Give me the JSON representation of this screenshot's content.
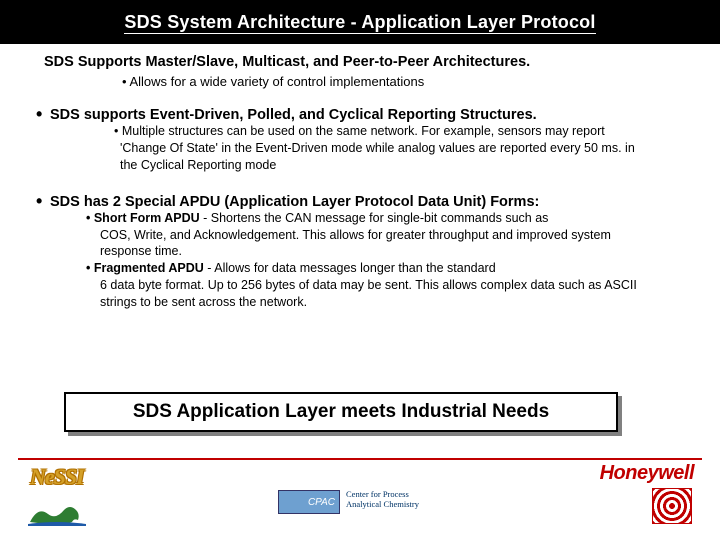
{
  "title": "SDS System Architecture - Application Layer Protocol",
  "sec1": {
    "head": "SDS Supports Master/Slave, Multicast, and Peer-to-Peer Architectures.",
    "sub": "•   Allows for a wide variety of control implementations"
  },
  "sec2": {
    "head": "SDS supports Event-Driven, Polled, and Cyclical Reporting Structures.",
    "sub": "• Multiple structures can be used on the same network.  For example, sensors may report 'Change Of State' in the Event-Driven mode while analog values are reported every 50 ms. in the Cyclical Reporting mode"
  },
  "sec3": {
    "head": "SDS has 2 Special APDU (Application Layer Protocol Data Unit) Forms:",
    "item1_lead": "• Short Form APDU",
    "item1_rest": " - Shortens the CAN message for single-bit commands such as",
    "item1_cont": "COS, Write, and Acknowledgement.  This allows for greater throughput and improved system response time.",
    "item2_lead": "• Fragmented APDU",
    "item2_rest": " - Allows for data messages longer than the standard",
    "item2_cont": "6 data byte format.  Up to 256 bytes of data may be sent.  This allows complex data such as ASCII strings to be sent across the network."
  },
  "callout": "SDS Application Layer meets Industrial Needs",
  "footer": {
    "nessi": "NeSSI",
    "cpac": "CPAC",
    "cpac_sub": "Center for Process\nAnalytical Chemistry",
    "honeywell": "Honeywell"
  }
}
